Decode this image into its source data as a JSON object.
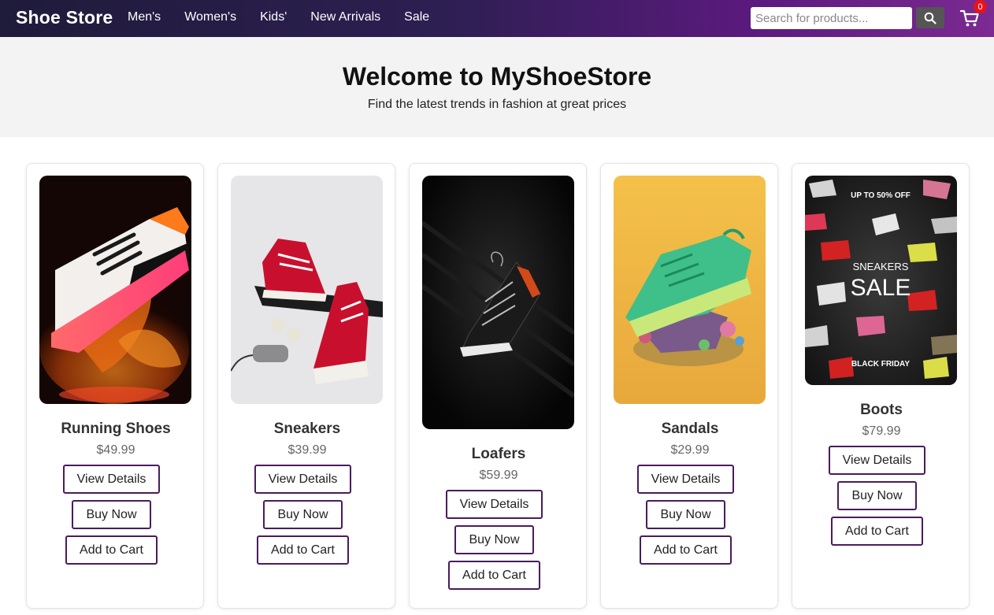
{
  "header": {
    "brand": "Shoe Store",
    "nav": [
      "Men's",
      "Women's",
      "Kids'",
      "New Arrivals",
      "Sale"
    ],
    "search_placeholder": "Search for products...",
    "cart_count": "0"
  },
  "hero": {
    "title": "Welcome to MyShoeStore",
    "subtitle": "Find the latest trends in fashion at great prices"
  },
  "products": [
    {
      "name": "Running Shoes",
      "price": "$49.99",
      "view": "View Details",
      "buy": "Buy Now",
      "add": "Add to Cart"
    },
    {
      "name": "Sneakers",
      "price": "$39.99",
      "view": "View Details",
      "buy": "Buy Now",
      "add": "Add to Cart"
    },
    {
      "name": "Loafers",
      "price": "$59.99",
      "view": "View Details",
      "buy": "Buy Now",
      "add": "Add to Cart"
    },
    {
      "name": "Sandals",
      "price": "$29.99",
      "view": "View Details",
      "buy": "Buy Now",
      "add": "Add to Cart"
    },
    {
      "name": "Boots",
      "price": "$79.99",
      "view": "View Details",
      "buy": "Buy Now",
      "add": "Add to Cart"
    }
  ],
  "promo": {
    "top": "UP TO 50% OFF",
    "line1": "SNEAKERS",
    "line2": "SALE",
    "bottom": "BLACK FRIDAY"
  },
  "colors": {
    "button_border": "#4a1b5e",
    "badge": "#e8131a"
  }
}
